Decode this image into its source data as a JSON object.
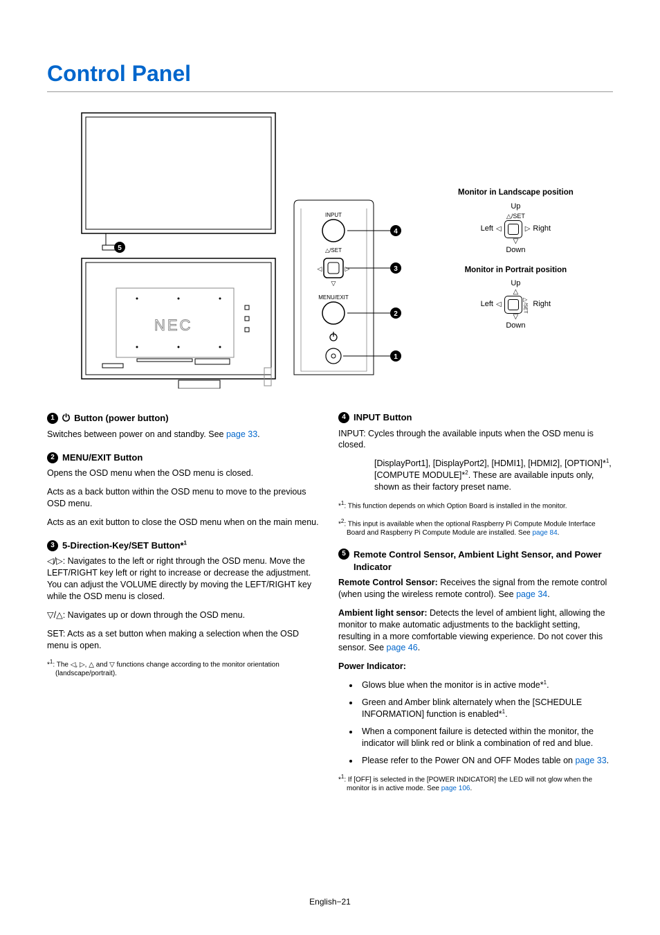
{
  "title": "Control Panel",
  "footer": "English−21",
  "diagram_labels": {
    "monitor_landscape": "Monitor in Landscape position",
    "monitor_portrait": "Monitor in Portrait position",
    "up": "Up",
    "down": "Down",
    "left": "Left",
    "right": "Right",
    "set": "/SET",
    "panel_input": "INPUT",
    "panel_set": "△/SET",
    "panel_menu": "MENU/EXIT",
    "callout1": "1",
    "callout2": "2",
    "callout3": "3",
    "callout4": "4",
    "callout5": "5",
    "brand": "NEC"
  },
  "sec1": {
    "num": "1",
    "title": "Button (power button)",
    "p1a": "Switches between power on and standby. See ",
    "p1link": "page 33",
    "p1b": "."
  },
  "sec2": {
    "num": "2",
    "title": "MENU/EXIT Button",
    "p1": "Opens the OSD menu when the OSD menu is closed.",
    "p2": "Acts as a back button within the OSD menu to move to the previous OSD menu.",
    "p3": "Acts as an exit button to close the OSD menu when on the main menu."
  },
  "sec3": {
    "num": "3",
    "title_a": "5-Direction-Key/SET Button*",
    "title_sup": "1",
    "p1": "◁/▷: Navigates to the left or right through the OSD menu. Move the LEFT/RIGHT key left or right to increase or decrease the adjustment.",
    "p1b": "You can adjust the VOLUME directly by moving the LEFT/RIGHT key while the OSD menu is closed.",
    "p2": "▽/△: Navigates up or down through the OSD menu.",
    "p3": "SET: Acts as a set button when making a selection when the OSD menu is open.",
    "fn_pre": "*",
    "fn_sup": "1",
    "fn": ": The ◁, ▷, △ and ▽ functions change according to the monitor orientation (landscape/portrait)."
  },
  "sec4": {
    "num": "4",
    "title": "INPUT Button",
    "p1": "INPUT: Cycles through the available inputs when the OSD menu is closed.",
    "indent_a": "[DisplayPort1], [DisplayPort2], [HDMI1], [HDMI2], [OPTION]*",
    "indent_sup1": "1",
    "indent_b": ", [COMPUTE MODULE]*",
    "indent_sup2": "2",
    "indent_c": ". These are available inputs only, shown as their factory preset name.",
    "fn1_pre": "*",
    "fn1_sup": "1",
    "fn1": ": This function depends on which Option Board is installed in the monitor.",
    "fn2_pre": "*",
    "fn2_sup": "2",
    "fn2a": ": This input is available when the optional Raspberry Pi Compute Module Interface Board and Raspberry Pi Compute Module are installed. See ",
    "fn2link": "page 84",
    "fn2b": "."
  },
  "sec5": {
    "num": "5",
    "title": "Remote Control Sensor, Ambient Light Sensor, and Power Indicator",
    "rcs_label": "Remote Control Sensor:",
    "rcs_a": " Receives the signal from the remote control (when using the wireless remote control). See ",
    "rcs_link": "page 34",
    "rcs_b": ".",
    "als_label": "Ambient light sensor:",
    "als_a": " Detects the level of ambient light, allowing the monitor to make automatic adjustments to the backlight setting, resulting in a more comfortable viewing experience. Do not cover this sensor. See ",
    "als_link": "page 46",
    "als_b": ".",
    "pi_label": "Power Indicator:",
    "b1a": "Glows blue when the monitor is in active mode*",
    "b1sup": "1",
    "b1b": ".",
    "b2a": "Green and Amber blink alternately when the [SCHEDULE INFORMATION] function is enabled*",
    "b2sup": "1",
    "b2b": ".",
    "b3": "When a component failure is detected within the monitor, the indicator will blink red or blink a combination of red and blue.",
    "b4a": "Please refer to the Power ON and OFF Modes table on ",
    "b4link": "page 33",
    "b4b": ".",
    "fn_pre": "*",
    "fn_sup": "1",
    "fn_a": ": If [OFF] is selected in the [POWER INDICATOR] the LED will not glow when the monitor is in active mode. See ",
    "fn_link": "page 106",
    "fn_b": "."
  }
}
